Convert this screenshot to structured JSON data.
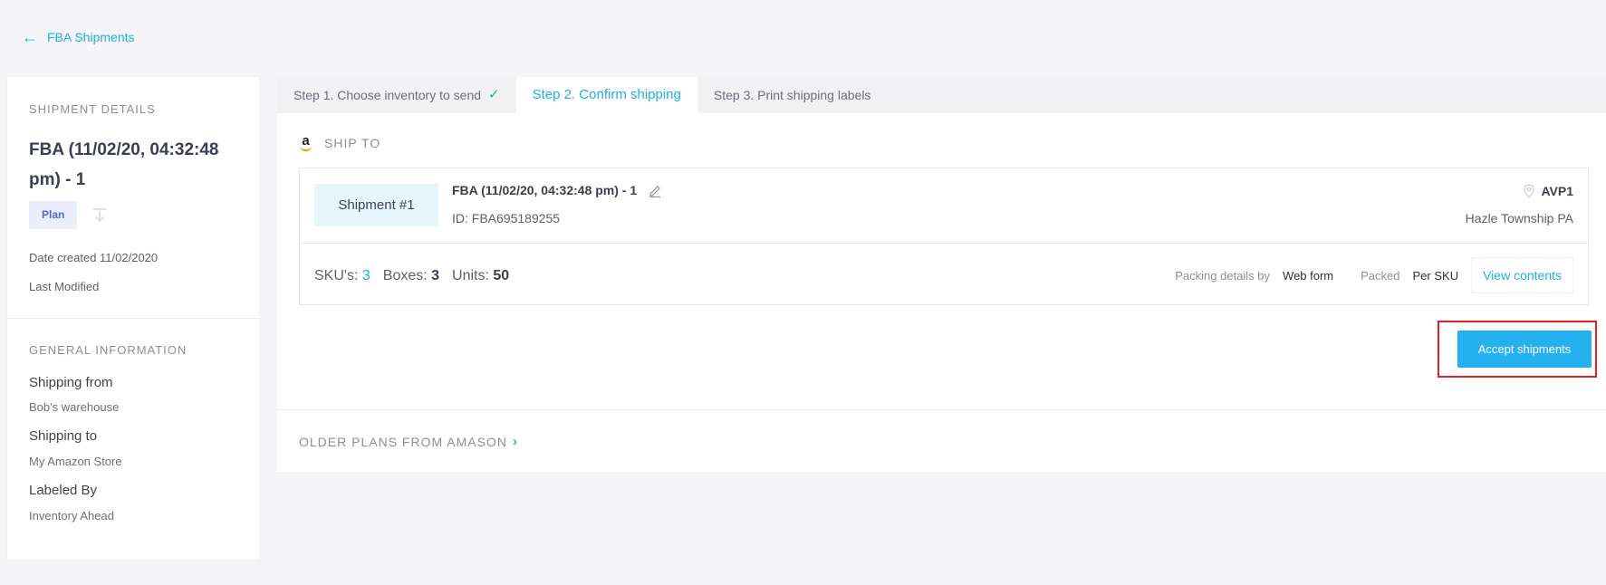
{
  "back_link": {
    "icon": "arrow-left-icon",
    "label": "FBA Shipments"
  },
  "sidebar": {
    "details_heading": "SHIPMENT DETAILS",
    "shipment_title": "FBA (11/02/20, 04:32:48 pm) - 1",
    "status_badge": "Plan",
    "date_created": "Date created 11/02/2020",
    "last_modified": "Last Modified",
    "general_heading": "GENERAL INFORMATION",
    "shipping_from_label": "Shipping from",
    "shipping_from_value": "Bob's warehouse",
    "shipping_to_label": "Shipping to",
    "shipping_to_value": "My Amazon Store",
    "labeled_by_label": "Labeled By",
    "labeled_by_value": "Inventory Ahead"
  },
  "tabs": [
    {
      "label": "Step 1. Choose inventory to send",
      "state": "completed"
    },
    {
      "label": "Step 2. Confirm shipping",
      "state": "active"
    },
    {
      "label": "Step 3. Print shipping labels",
      "state": "inactive"
    }
  ],
  "ship_to": {
    "label": "SHIP TO",
    "icon": "amazon-icon"
  },
  "shipment": {
    "number_label": "Shipment #1",
    "name": "FBA (11/02/20, 04:32:48 pm) - 1",
    "id_text": "ID: FBA695189255",
    "destination_code": "AVP1",
    "destination_city": "Hazle Township PA",
    "skus_label": "SKU's:",
    "skus_value": "3",
    "boxes_label": "Boxes:",
    "boxes_value": "3",
    "units_label": "Units:",
    "units_value": "50",
    "packing_label": "Packing details by",
    "packing_value": "Web form",
    "packed_label": "Packed",
    "packed_value": "Per SKU",
    "view_contents": "View contents"
  },
  "accept_button": "Accept shipments",
  "older_plans": "OLDER PLANS FROM AMASON",
  "colors": {
    "accent": "#1eaee8",
    "button": "#25b1ef",
    "highlight": "#e41f1f",
    "check": "#1fb97a"
  }
}
